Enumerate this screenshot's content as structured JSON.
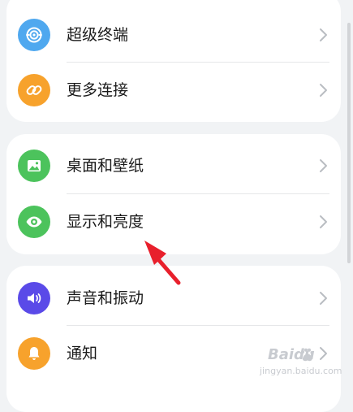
{
  "settings": {
    "group1": {
      "items": [
        {
          "label": "超级终端",
          "icon": "super-device-icon",
          "color": "#4FA8EF"
        },
        {
          "label": "更多连接",
          "icon": "link-icon",
          "color": "#F7A22C"
        }
      ]
    },
    "group2": {
      "items": [
        {
          "label": "桌面和壁纸",
          "icon": "wallpaper-icon",
          "color": "#4CC35C"
        },
        {
          "label": "显示和亮度",
          "icon": "eye-icon",
          "color": "#4CC35C"
        }
      ]
    },
    "group3": {
      "items": [
        {
          "label": "声音和振动",
          "icon": "speaker-icon",
          "color": "#5A4AE8"
        },
        {
          "label": "通知",
          "icon": "bell-icon",
          "color": "#F7A22C"
        }
      ]
    }
  },
  "watermark": {
    "brand": "Baidu",
    "site": "jingyan.baidu.com"
  },
  "colors": {
    "background": "#F1F3F5",
    "card": "#FFFFFF",
    "arrow": "#E8202C"
  }
}
